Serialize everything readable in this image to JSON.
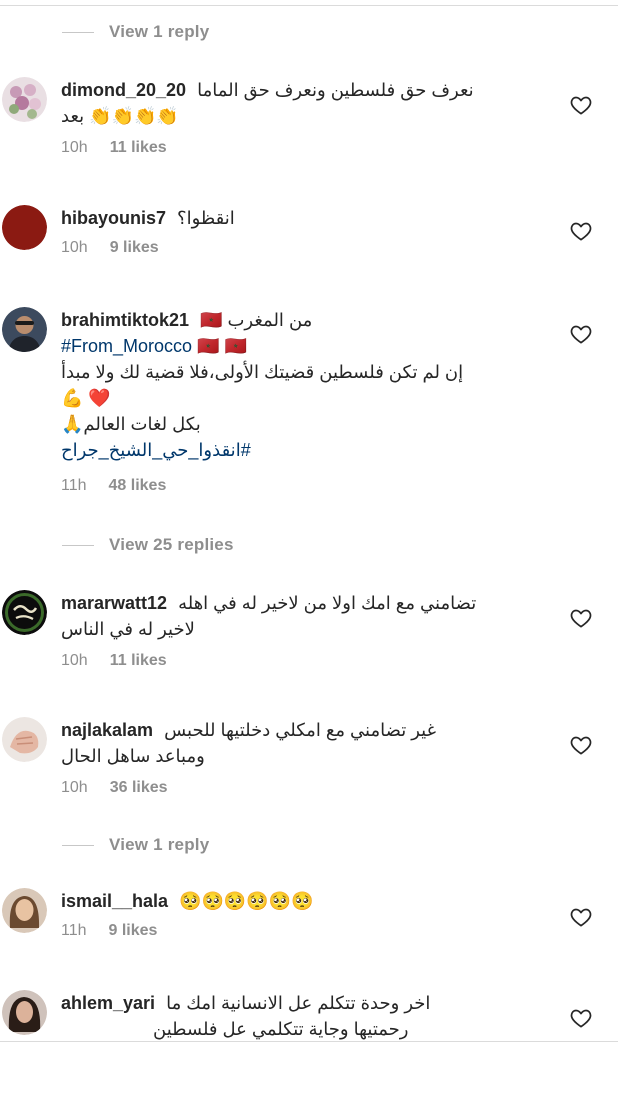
{
  "replies_toggles": [
    {
      "label": "View 1 reply"
    },
    {
      "label": "View 25 replies"
    },
    {
      "label": "View 1 reply"
    }
  ],
  "comments": [
    {
      "username": "dimond_20_20",
      "text_lines": [
        "نعرف حق فلسطين ونعرف حق الماما",
        "👏👏👏👏 بعد"
      ],
      "time": "10h",
      "likes": "11 likes"
    },
    {
      "username": "hibayounis7",
      "text_lines": [
        "انقظوا؟"
      ],
      "time": "10h",
      "likes": "9 likes"
    },
    {
      "username": "brahimtiktok21",
      "text_lines": [
        "من المغرب 🇲🇦",
        "#From_Morocco 🇲🇦 🇲🇦",
        "إن لم تكن فلسطين قضيتك الأولى،فلا قضية لك ولا مبدأ",
        "💪 ❤️",
        "بكل لغات العالم🙏",
        "#انقذوا_حي_الشيخ_جراح"
      ],
      "time": "11h",
      "likes": "48 likes"
    },
    {
      "username": "mararwatt12",
      "text_lines": [
        "تضامني مع امك اولا من لاخير له في اهله",
        "لاخير له في الناس"
      ],
      "time": "10h",
      "likes": "11 likes"
    },
    {
      "username": "najlakalam",
      "text_lines": [
        "غير تضامني مع امكلي دخلتيها للحبس",
        "ومباعد ساهل الحال"
      ],
      "time": "10h",
      "likes": "36 likes"
    },
    {
      "username": "ismail__hala",
      "text_lines": [
        "🥺🥺🥺🥺🥺🥺"
      ],
      "time": "11h",
      "likes": "9 likes"
    },
    {
      "username": "ahlem_yari",
      "text_lines": [
        "اخر وحدة تتكلم عل الانسانية امك ما",
        "رحمتيها وجاية تتكلمي عل فلسطين"
      ],
      "time": "",
      "likes": ""
    }
  ],
  "icons": {
    "like": "heart-outline-icon",
    "avatar": "user-avatar"
  },
  "colors": {
    "text": "#262626",
    "meta": "#8e8e8e",
    "hashtag": "#00376b",
    "divider": "#dbdbdb"
  }
}
